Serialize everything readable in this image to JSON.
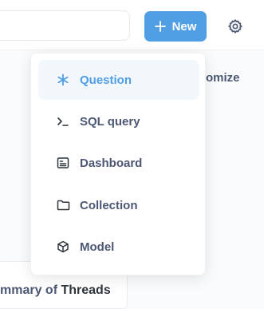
{
  "header": {
    "new_button_label": "New",
    "accent_color": "#509ee3"
  },
  "background": {
    "right_partial_text": "omize",
    "card_title_prefix": "mmary of ",
    "card_title_strong": "Threads"
  },
  "menu": {
    "items": [
      {
        "label": "Question",
        "icon": "star-burst-icon",
        "active": true
      },
      {
        "label": "SQL query",
        "icon": "terminal-prompt-icon",
        "active": false
      },
      {
        "label": "Dashboard",
        "icon": "dashboard-icon",
        "active": false
      },
      {
        "label": "Collection",
        "icon": "folder-icon",
        "active": false
      },
      {
        "label": "Model",
        "icon": "cube-icon",
        "active": false
      }
    ]
  }
}
